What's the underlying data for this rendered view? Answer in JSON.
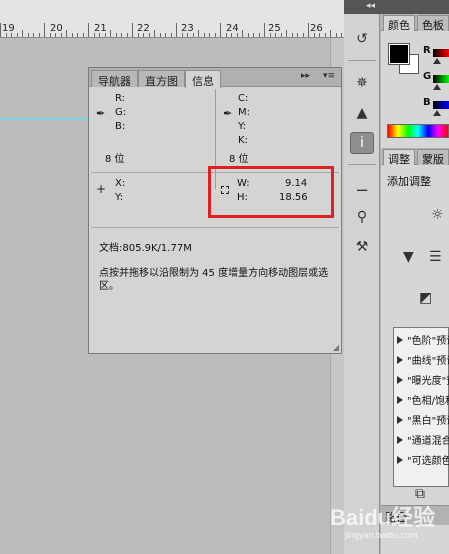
{
  "ruler": {
    "labels": [
      "19",
      "20",
      "21",
      "22",
      "23",
      "24",
      "25",
      "26"
    ]
  },
  "info_panel": {
    "tabs": [
      "导航器",
      "直方图",
      "信息"
    ],
    "active_tab": "信息",
    "rgb_labels": [
      "R:",
      "G:",
      "B:"
    ],
    "cmyk_labels": [
      "C:",
      "M:",
      "Y:",
      "K:"
    ],
    "bits_left": "8 位",
    "bits_right": "8 位",
    "x_label": "X:",
    "y_label": "Y:",
    "w_label": "W:",
    "w_value": "9.14",
    "h_label": "H:",
    "h_value": "18.56",
    "doc_status": "文档:805.9K/1.77M",
    "hint": "点按并拖移以沿限制为 45 度增量方向移动图层或选区。",
    "ctrl_collapse": "▸▸",
    "ctrl_menu": "▾≡"
  },
  "dock": {
    "collapse": "◂◂",
    "icons": [
      "history-icon",
      "navigator-icon",
      "histogram-icon",
      "info-icon",
      "brush-preset-icon",
      "clone-source-icon",
      "tool-preset-icon"
    ]
  },
  "color_panel": {
    "tabs": [
      "颜色",
      "色板"
    ],
    "r": "R",
    "g": "G",
    "b": "B"
  },
  "adjust_panel": {
    "tabs": [
      "调整",
      "蒙版"
    ],
    "title": "添加调整",
    "presets": [
      "\"色阶\"预设",
      "\"曲线\"预设",
      "\"曝光度\"预设",
      "\"色相/饱和度\"预设",
      "\"黑白\"预设",
      "\"通道混合器\"预设",
      "\"可选颜色\"预设"
    ]
  },
  "paths_panel": {
    "tab": "路径"
  },
  "watermark": {
    "text": "Baidu经验",
    "sub": "jingyan.baidu.com"
  }
}
